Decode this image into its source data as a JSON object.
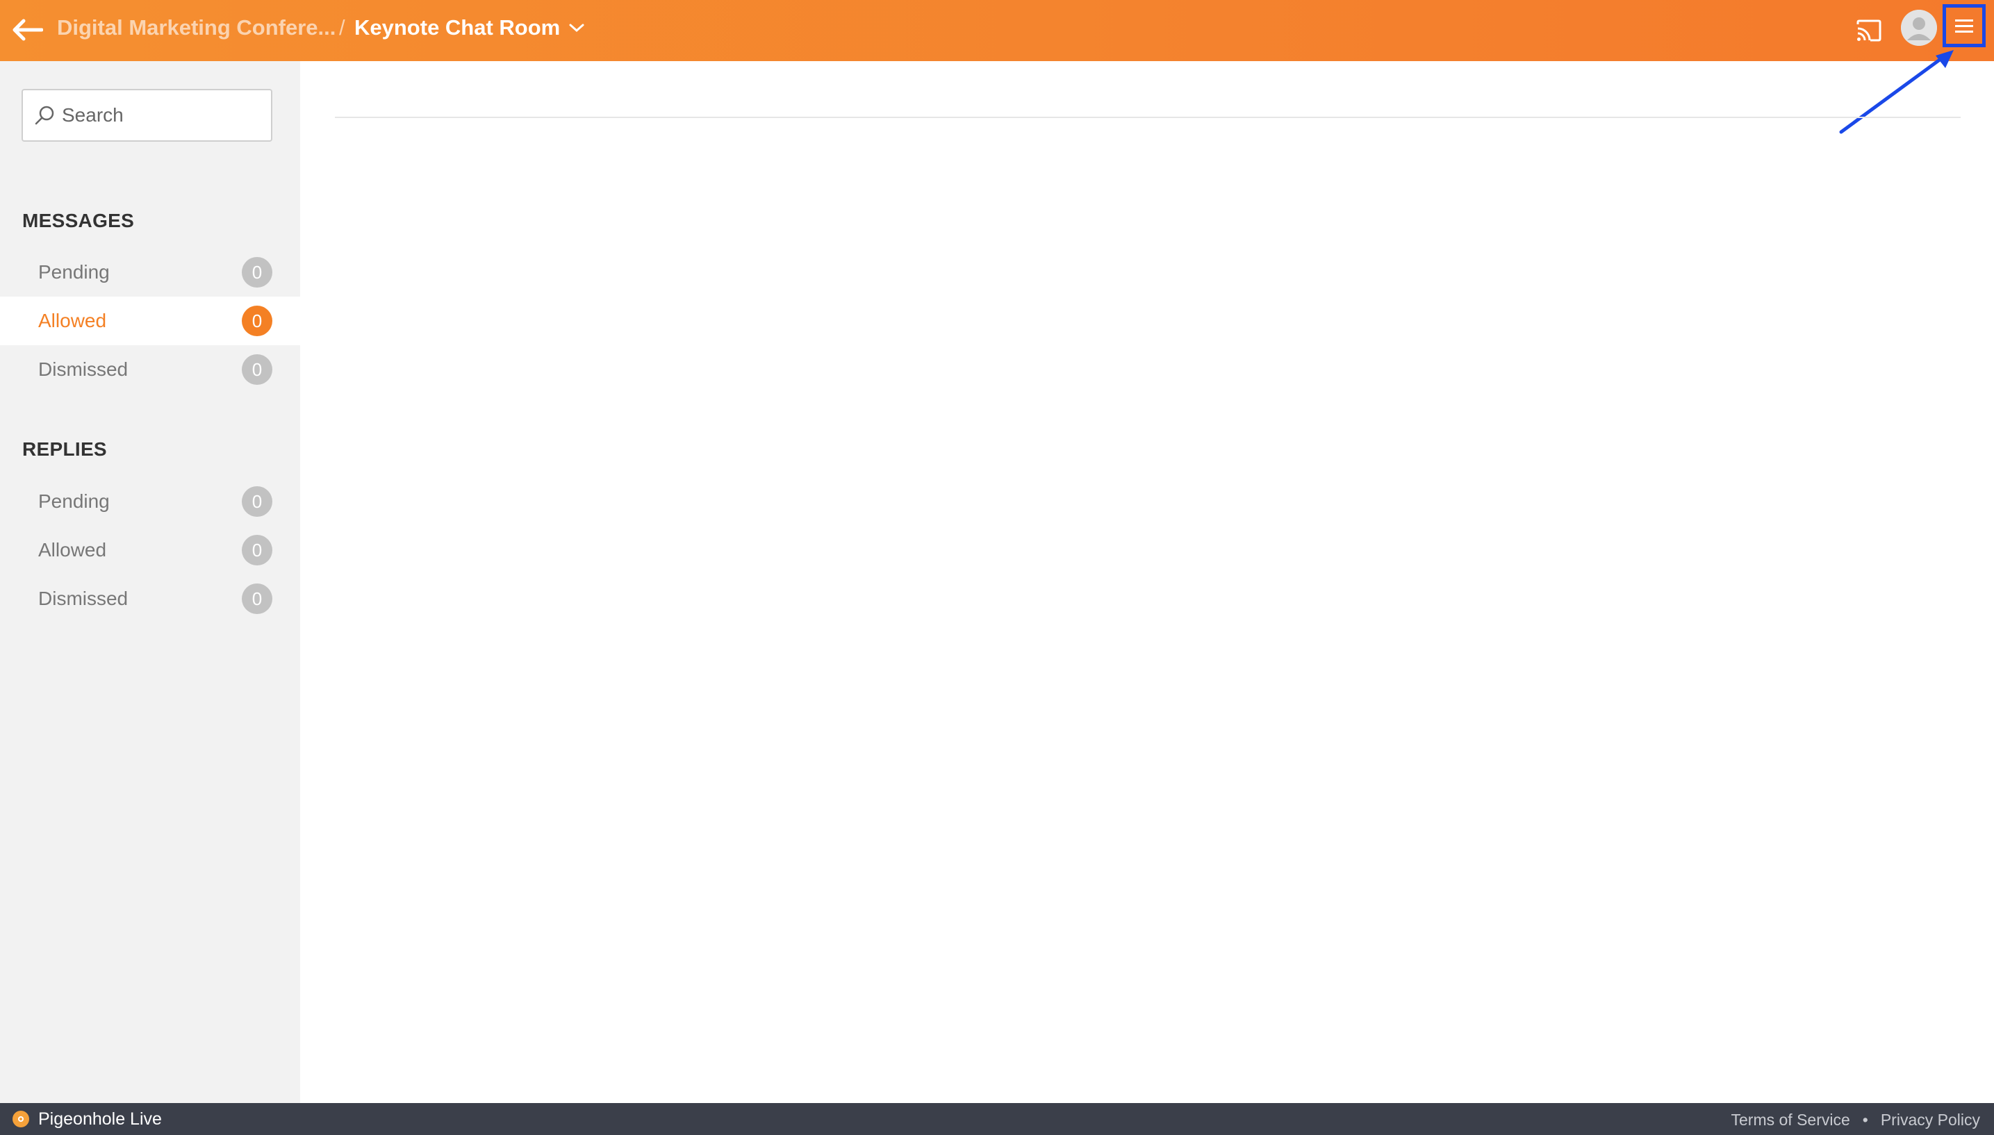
{
  "header": {
    "parent_title": "Digital Marketing Confere...",
    "separator": "/",
    "current_title": "Keynote Chat Room"
  },
  "sidebar": {
    "search": {
      "placeholder": "Search"
    },
    "messages": {
      "title": "MESSAGES",
      "items": [
        {
          "label": "Pending",
          "count": "0"
        },
        {
          "label": "Allowed",
          "count": "0",
          "active": true
        },
        {
          "label": "Dismissed",
          "count": "0"
        }
      ]
    },
    "replies": {
      "title": "REPLIES",
      "items": [
        {
          "label": "Pending",
          "count": "0"
        },
        {
          "label": "Allowed",
          "count": "0"
        },
        {
          "label": "Dismissed",
          "count": "0"
        }
      ]
    }
  },
  "footer": {
    "brand": "Pigeonhole Live",
    "terms": "Terms of Service",
    "dot": "•",
    "privacy": "Privacy Policy"
  },
  "colors": {
    "header_start": "#f58f30",
    "header_end": "#f47a2c",
    "accent": "#f48024",
    "annotation": "#1a48e8",
    "footer": "#3b3f4a"
  },
  "icons": [
    "back-arrow-icon",
    "chevron-down-icon",
    "cast-icon",
    "avatar-icon",
    "hamburger-menu-icon",
    "search-icon",
    "pigeonhole-logo-icon"
  ]
}
